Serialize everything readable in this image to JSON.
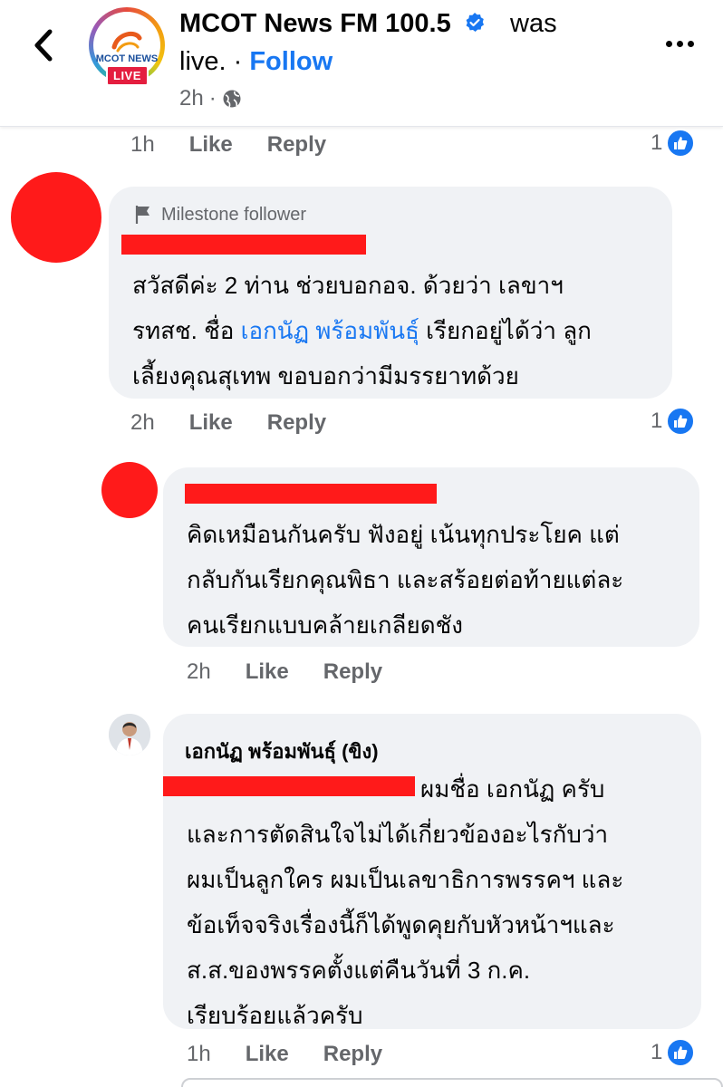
{
  "header": {
    "page_name": "MCOT News FM 100.5",
    "was": "was",
    "live": "live. · ",
    "follow": "Follow",
    "time": "2h",
    "privacy_icon": "globe-icon",
    "live_badge": "LIVE",
    "logo_text": "MCOT NEWS"
  },
  "top_actions": {
    "time": "1h",
    "like": "Like",
    "reply": "Reply",
    "count": "1"
  },
  "comment1": {
    "badge": "Milestone follower",
    "line1": "สวัสดีค่ะ 2 ท่าน ช่วยบอกอจ. ด้วยว่า เลขาฯ",
    "line2_pre": "รทสช. ชื่อ ",
    "line2_link": "เอกนัฏ พร้อมพันธุ์",
    "line2_post": " เรียกอยู่ได้ว่า ลูก",
    "line3": "เลี้ยงคุณสุเทพ ขอบอกว่ามีมรรยาทด้วย",
    "actions": {
      "time": "2h",
      "like": "Like",
      "reply": "Reply",
      "count": "1"
    }
  },
  "comment2": {
    "line1": "คิดเหมือนกันครับ ฟังอยู่ เน้นทุกประโยค แต่",
    "line2": "กลับกันเรียกคุณพิธา และสร้อยต่อท้ายแต่ละ",
    "line3": "คนเรียกแบบคล้ายเกลียดชัง",
    "actions": {
      "time": "2h",
      "like": "Like",
      "reply": "Reply"
    }
  },
  "comment3": {
    "author": "เอกนัฏ พร้อมพันธุ์ (ขิง)",
    "line1": "ผมชื่อ เอกนัฏ ครับ",
    "line2": "และการตัดสินใจไม่ได้เกี่ยวข้องอะไรกับว่า",
    "line3": "ผมเป็นลูกใคร ผมเป็นเลขาธิการพรรคฯ และ",
    "line4": "ข้อเท็จจริงเรื่องนี้ก็ได้พูดคุยกับหัวหน้าฯและ",
    "line5": "ส.ส.ของพรรคตั้งแต่คืนวันที่ 3 ก.ค.",
    "line6": "เรียบร้อยแล้วครับ",
    "actions": {
      "time": "1h",
      "like": "Like",
      "reply": "Reply",
      "count": "1"
    }
  },
  "colors": {
    "accent": "#1877f2",
    "bubble": "#f0f2f5",
    "redaction": "#ff1a1a",
    "muted": "#65676b"
  }
}
